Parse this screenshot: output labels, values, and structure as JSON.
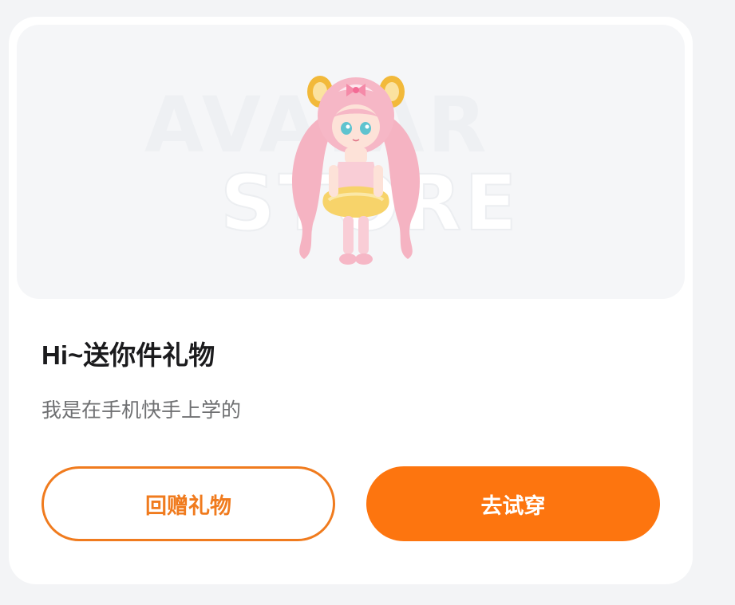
{
  "card": {
    "watermark_line1": "AVATAR",
    "watermark_line2": "STORE",
    "title": "Hi~送你件礼物",
    "subtitle": "我是在手机快手上学的",
    "buttons": {
      "return_gift": "回赠礼物",
      "try_on": "去试穿"
    }
  },
  "colors": {
    "accent": "#fd750f",
    "outline": "#f07b1e",
    "title": "#1b1b1d",
    "subtitle": "#6f7072",
    "page_bg": "#f3f4f6"
  }
}
